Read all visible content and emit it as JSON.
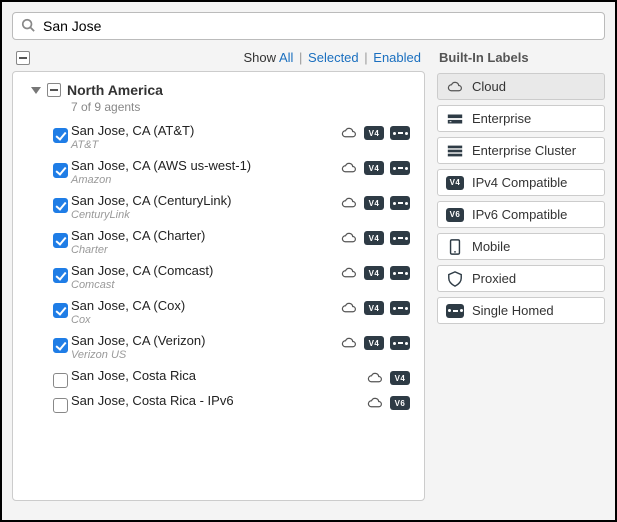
{
  "search": {
    "value": "San Jose"
  },
  "filters": {
    "show_label": "Show",
    "all": "All",
    "selected": "Selected",
    "enabled": "Enabled"
  },
  "group": {
    "name": "North America",
    "subtitle": "7 of 9 agents"
  },
  "agents": [
    {
      "name": "San Jose, CA (AT&T)",
      "provider": "AT&T",
      "checked": true,
      "icons": [
        "cloud",
        "v4",
        "sh"
      ]
    },
    {
      "name": "San Jose, CA (AWS us-west-1)",
      "provider": "Amazon",
      "checked": true,
      "icons": [
        "cloud",
        "v4",
        "sh"
      ]
    },
    {
      "name": "San Jose, CA (CenturyLink)",
      "provider": "CenturyLink",
      "checked": true,
      "icons": [
        "cloud",
        "v4",
        "sh"
      ]
    },
    {
      "name": "San Jose, CA (Charter)",
      "provider": "Charter",
      "checked": true,
      "icons": [
        "cloud",
        "v4",
        "sh"
      ]
    },
    {
      "name": "San Jose, CA (Comcast)",
      "provider": "Comcast",
      "checked": true,
      "icons": [
        "cloud",
        "v4",
        "sh"
      ]
    },
    {
      "name": "San Jose, CA (Cox)",
      "provider": "Cox",
      "checked": true,
      "icons": [
        "cloud",
        "v4",
        "sh"
      ]
    },
    {
      "name": "San Jose, CA (Verizon)",
      "provider": "Verizon US",
      "checked": true,
      "icons": [
        "cloud",
        "v4",
        "sh"
      ]
    },
    {
      "name": "San Jose, Costa Rica",
      "provider": "",
      "checked": false,
      "icons": [
        "cloud",
        "v4"
      ]
    },
    {
      "name": "San Jose, Costa Rica - IPv6",
      "provider": "",
      "checked": false,
      "icons": [
        "cloud",
        "v6"
      ]
    }
  ],
  "labels_title": "Built-In Labels",
  "labels": [
    {
      "name": "Cloud",
      "icon": "cloud",
      "active": true
    },
    {
      "name": "Enterprise",
      "icon": "enterprise",
      "active": false
    },
    {
      "name": "Enterprise Cluster",
      "icon": "cluster",
      "active": false
    },
    {
      "name": "IPv4 Compatible",
      "icon": "v4",
      "active": false
    },
    {
      "name": "IPv6 Compatible",
      "icon": "v6",
      "active": false
    },
    {
      "name": "Mobile",
      "icon": "mobile",
      "active": false
    },
    {
      "name": "Proxied",
      "icon": "proxied",
      "active": false
    },
    {
      "name": "Single Homed",
      "icon": "sh",
      "active": false
    }
  ]
}
